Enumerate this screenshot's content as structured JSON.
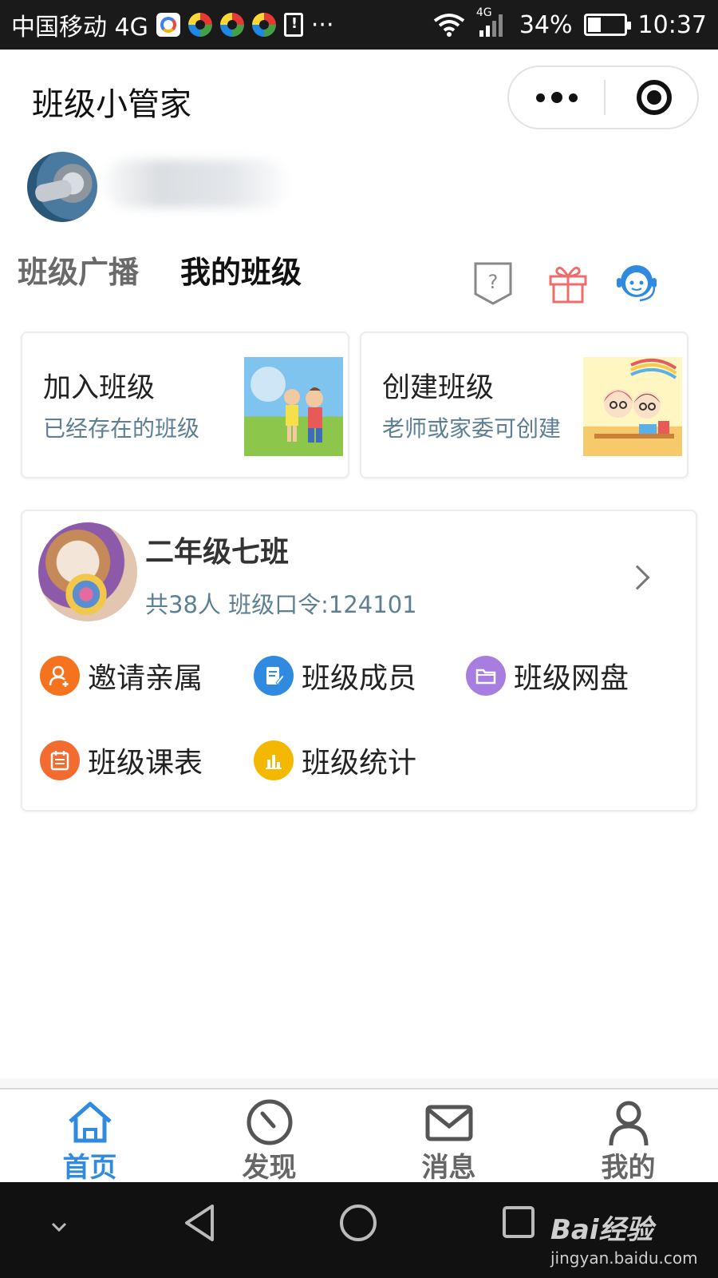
{
  "status_bar": {
    "carrier": "中国移动 4G",
    "more": "···",
    "network": "4G",
    "battery": "34%",
    "battery_level": 0.34,
    "time": "10:37"
  },
  "header": {
    "title": "班级小管家"
  },
  "tabs": {
    "broadcast": "班级广播",
    "my_class": "我的班级"
  },
  "cards": {
    "join": {
      "title": "加入班级",
      "subtitle": "已经存在的班级"
    },
    "create": {
      "title": "创建班级",
      "subtitle": "老师或家委可创建"
    }
  },
  "class_card": {
    "name": "二年级七班",
    "meta": "共38人 班级口令:124101",
    "functions": [
      {
        "label": "邀请亲属",
        "icon": "add-user-icon",
        "color": "#f5731f"
      },
      {
        "label": "班级成员",
        "icon": "member-list-icon",
        "color": "#2f8ae0"
      },
      {
        "label": "班级网盘",
        "icon": "folder-icon",
        "color": "#a77de0"
      },
      {
        "label": "班级课表",
        "icon": "calendar-icon",
        "color": "#f36b2f"
      },
      {
        "label": "班级统计",
        "icon": "bar-chart-icon",
        "color": "#f4b800"
      }
    ]
  },
  "bottom_nav": [
    {
      "label": "首页",
      "icon": "home-icon",
      "active": true
    },
    {
      "label": "发现",
      "icon": "compass-icon",
      "active": false
    },
    {
      "label": "消息",
      "icon": "mail-icon",
      "active": false
    },
    {
      "label": "我的",
      "icon": "person-icon",
      "active": false
    }
  ],
  "watermark": {
    "brand": "Bai经验",
    "url": "jingyan.baidu.com"
  },
  "colors": {
    "accent": "#2f8ae0",
    "subtitle_text": "#5d7f93",
    "gift_icon": "#ef6d6d",
    "service_icon": "#2f8ae0"
  }
}
